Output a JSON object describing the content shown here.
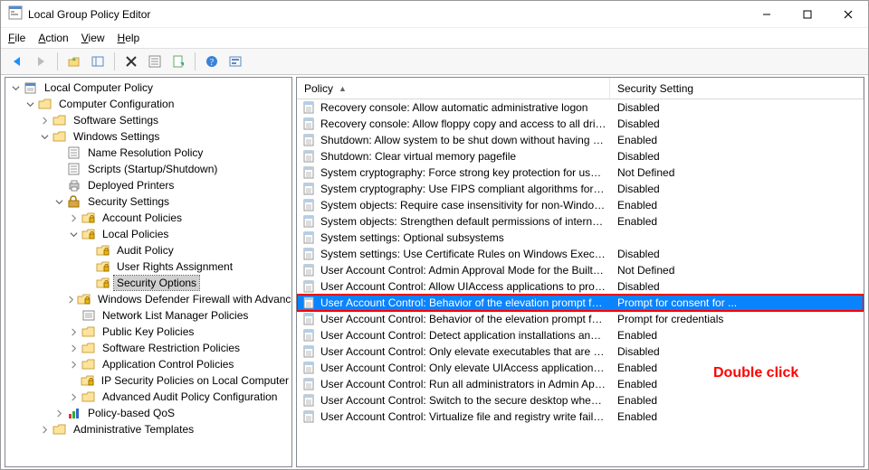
{
  "window": {
    "title": "Local Group Policy Editor"
  },
  "menu": {
    "file": "File",
    "action": "Action",
    "view": "View",
    "help": "Help"
  },
  "tree": {
    "root": "Local Computer Policy",
    "cc": "Computer Configuration",
    "ss": "Software Settings",
    "ws": "Windows Settings",
    "nrp": "Name Resolution Policy",
    "scripts": "Scripts (Startup/Shutdown)",
    "dp": "Deployed Printers",
    "sec": "Security Settings",
    "ap": "Account Policies",
    "lp": "Local Policies",
    "audit": "Audit Policy",
    "ura": "User Rights Assignment",
    "so": "Security Options",
    "wdf": "Windows Defender Firewall with Advanced Security",
    "nlmp": "Network List Manager Policies",
    "pkp": "Public Key Policies",
    "srp": "Software Restriction Policies",
    "acp": "Application Control Policies",
    "ipsec": "IP Security Policies on Local Computer",
    "aapc": "Advanced Audit Policy Configuration",
    "pqos": "Policy-based QoS",
    "at": "Administrative Templates"
  },
  "list": {
    "headers": {
      "policy": "Policy",
      "setting": "Security Setting"
    },
    "rows": [
      {
        "policy": "Recovery console: Allow automatic administrative logon",
        "setting": "Disabled"
      },
      {
        "policy": "Recovery console: Allow floppy copy and access to all drives...",
        "setting": "Disabled"
      },
      {
        "policy": "Shutdown: Allow system to be shut down without having to...",
        "setting": "Enabled"
      },
      {
        "policy": "Shutdown: Clear virtual memory pagefile",
        "setting": "Disabled"
      },
      {
        "policy": "System cryptography: Force strong key protection for user k...",
        "setting": "Not Defined"
      },
      {
        "policy": "System cryptography: Use FIPS compliant algorithms for en...",
        "setting": "Disabled"
      },
      {
        "policy": "System objects: Require case insensitivity for non-Windows ...",
        "setting": "Enabled"
      },
      {
        "policy": "System objects: Strengthen default permissions of internal s...",
        "setting": "Enabled"
      },
      {
        "policy": "System settings: Optional subsystems",
        "setting": ""
      },
      {
        "policy": "System settings: Use Certificate Rules on Windows Executabl...",
        "setting": "Disabled"
      },
      {
        "policy": "User Account Control: Admin Approval Mode for the Built-i...",
        "setting": "Not Defined"
      },
      {
        "policy": "User Account Control: Allow UIAccess applications to prom...",
        "setting": "Disabled"
      },
      {
        "policy": "User Account Control: Behavior of the elevation prompt for ...",
        "setting": "Prompt for consent for ...",
        "selected": true
      },
      {
        "policy": "User Account Control: Behavior of the elevation prompt for ...",
        "setting": "Prompt for credentials"
      },
      {
        "policy": "User Account Control: Detect application installations and p...",
        "setting": "Enabled"
      },
      {
        "policy": "User Account Control: Only elevate executables that are sign...",
        "setting": "Disabled"
      },
      {
        "policy": "User Account Control: Only elevate UIAccess applications th...",
        "setting": "Enabled"
      },
      {
        "policy": "User Account Control: Run all administrators in Admin Appr...",
        "setting": "Enabled"
      },
      {
        "policy": "User Account Control: Switch to the secure desktop when pr...",
        "setting": "Enabled"
      },
      {
        "policy": "User Account Control: Virtualize file and registry write failure...",
        "setting": "Enabled"
      }
    ]
  },
  "annotation": "Double click"
}
